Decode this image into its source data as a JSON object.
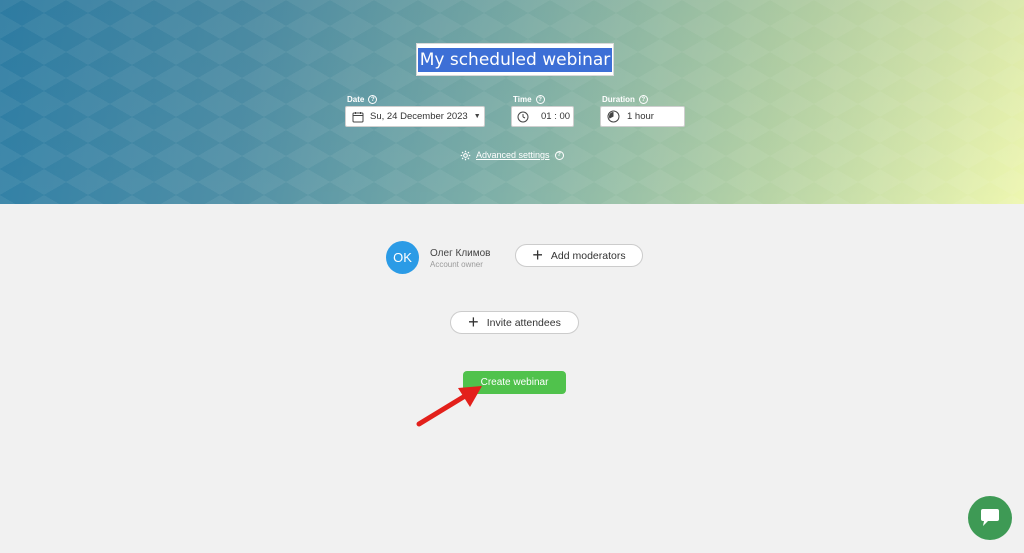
{
  "header": {
    "webinar_title": "My scheduled webinar",
    "date_label": "Date",
    "date_value": "Su, 24 December 2023",
    "time_label": "Time",
    "time_value": "01 : 00",
    "duration_label": "Duration",
    "duration_value": "1 hour",
    "help_glyph": "?",
    "advanced_settings": "Advanced settings"
  },
  "owner": {
    "initials": "OK",
    "name": "Олег Климов",
    "role": "Account owner"
  },
  "buttons": {
    "add_moderators": "Add moderators",
    "invite_attendees": "Invite attendees",
    "create_webinar": "Create webinar",
    "plus_glyph": "+"
  },
  "icons": {
    "calendar": "calendar-icon",
    "clock": "clock-icon",
    "duration": "timer-icon",
    "gear": "gear-icon",
    "help": "help-icon",
    "chat": "chat-icon",
    "annotation": "red-arrow-annotation"
  },
  "colors": {
    "create_button": "#50c24c",
    "avatar": "#2b9be6",
    "chat_button": "#3e9a55",
    "selection": "#3d6fd6",
    "annotation_arrow": "#e3201b"
  }
}
